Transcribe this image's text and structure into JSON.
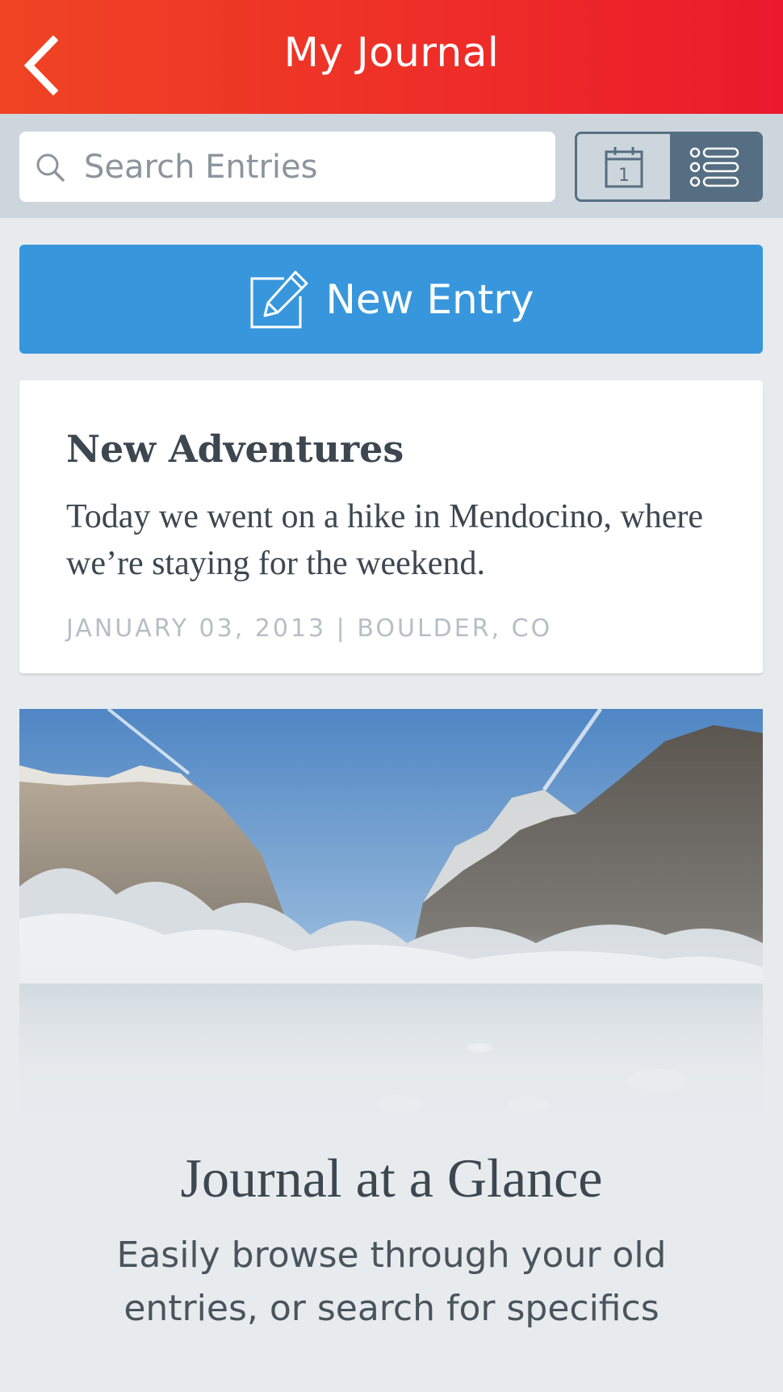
{
  "header": {
    "title": "My Journal",
    "back_icon": "chevron-left-icon"
  },
  "search": {
    "placeholder": "Search Entries",
    "icon": "search-icon"
  },
  "view_toggle": {
    "calendar_icon": "calendar-icon",
    "calendar_day": "1",
    "list_icon": "list-icon",
    "active": "list"
  },
  "new_entry": {
    "label": "New Entry",
    "icon": "edit-icon"
  },
  "entry": {
    "title": "New Adventures",
    "body": "Today we went on a hike in Mendocino, where we’re staying for the weekend.",
    "meta": "JANUARY 03, 2013 | BOULDER, CO"
  },
  "promo": {
    "title": "Journal at a Glance",
    "subtitle": "Easily browse through your old entries, or search for specifics"
  },
  "colors": {
    "header_red": "#ee2c28",
    "accent_blue": "#3897dc",
    "toggle_slate": "#566e82",
    "background": "#e7ebee"
  }
}
